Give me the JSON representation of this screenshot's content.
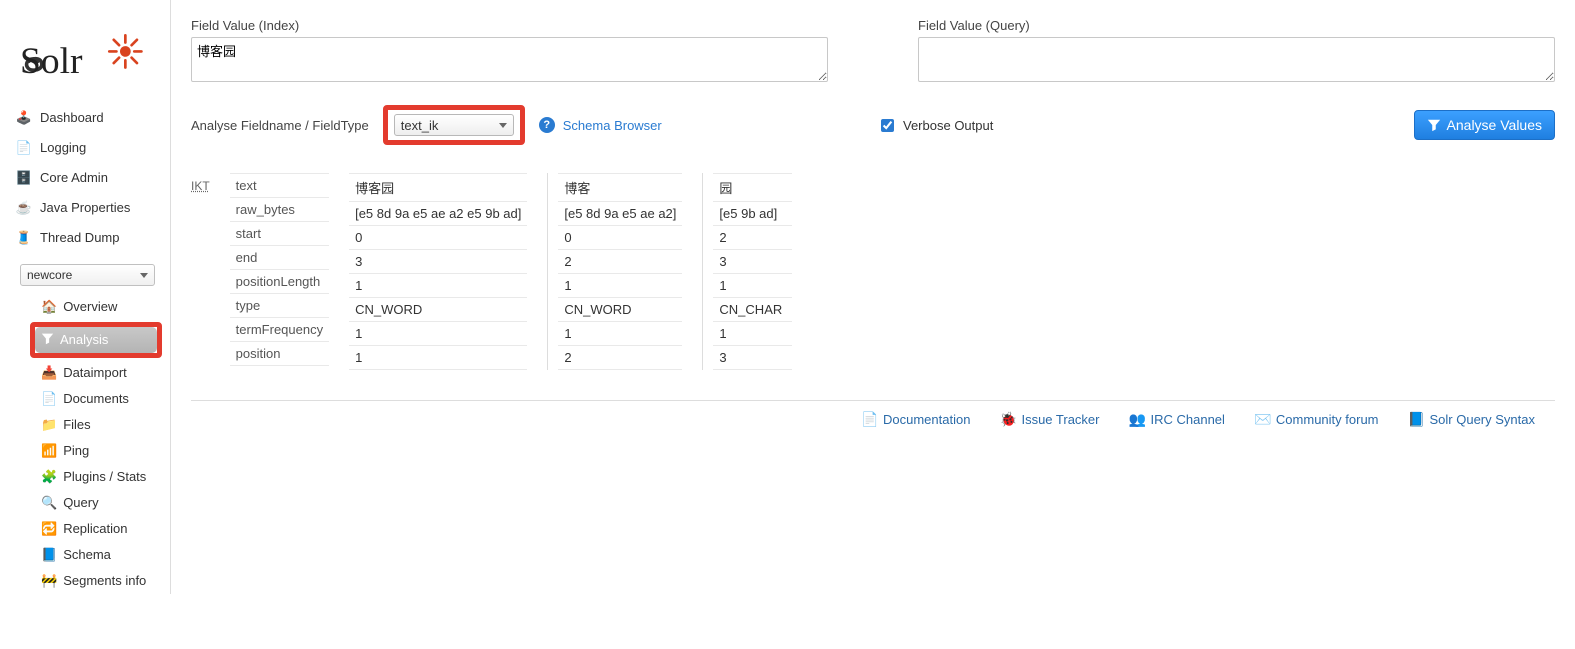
{
  "sidebar": {
    "core_selected": "newcore",
    "nav": {
      "dashboard": "Dashboard",
      "logging": "Logging",
      "core_admin": "Core Admin",
      "java_props": "Java Properties",
      "thread_dump": "Thread Dump"
    },
    "subnav": {
      "overview": "Overview",
      "analysis": "Analysis",
      "dataimport": "Dataimport",
      "documents": "Documents",
      "files": "Files",
      "ping": "Ping",
      "plugins": "Plugins / Stats",
      "query": "Query",
      "replication": "Replication",
      "schema": "Schema",
      "segments": "Segments info"
    }
  },
  "analysis": {
    "index_label": "Field Value (Index)",
    "index_value": "博客园",
    "query_label": "Field Value (Query)",
    "query_value": "",
    "field_prefix": "Analyse Fieldname / FieldType",
    "fieldtype_selected": "text_ik",
    "schema_link": "Schema Browser",
    "verbose_label": "Verbose Output",
    "verbose_checked": true,
    "button": "Analyse Values",
    "analyzer_tag": "IKT",
    "attrs": [
      "text",
      "raw_bytes",
      "start",
      "end",
      "positionLength",
      "type",
      "termFrequency",
      "position"
    ],
    "tokens": [
      {
        "values": [
          "博客园",
          "[e5 8d 9a e5 ae a2 e5 9b ad]",
          "0",
          "3",
          "1",
          "CN_WORD",
          "1",
          "1"
        ]
      },
      {
        "values": [
          "博客",
          "[e5 8d 9a e5 ae a2]",
          "0",
          "2",
          "1",
          "CN_WORD",
          "1",
          "2"
        ]
      },
      {
        "values": [
          "园",
          "[e5 9b ad]",
          "2",
          "3",
          "1",
          "CN_CHAR",
          "1",
          "3"
        ]
      }
    ]
  },
  "footer": {
    "documentation": "Documentation",
    "issue_tracker": "Issue Tracker",
    "irc": "IRC Channel",
    "forum": "Community forum",
    "syntax": "Solr Query Syntax"
  }
}
